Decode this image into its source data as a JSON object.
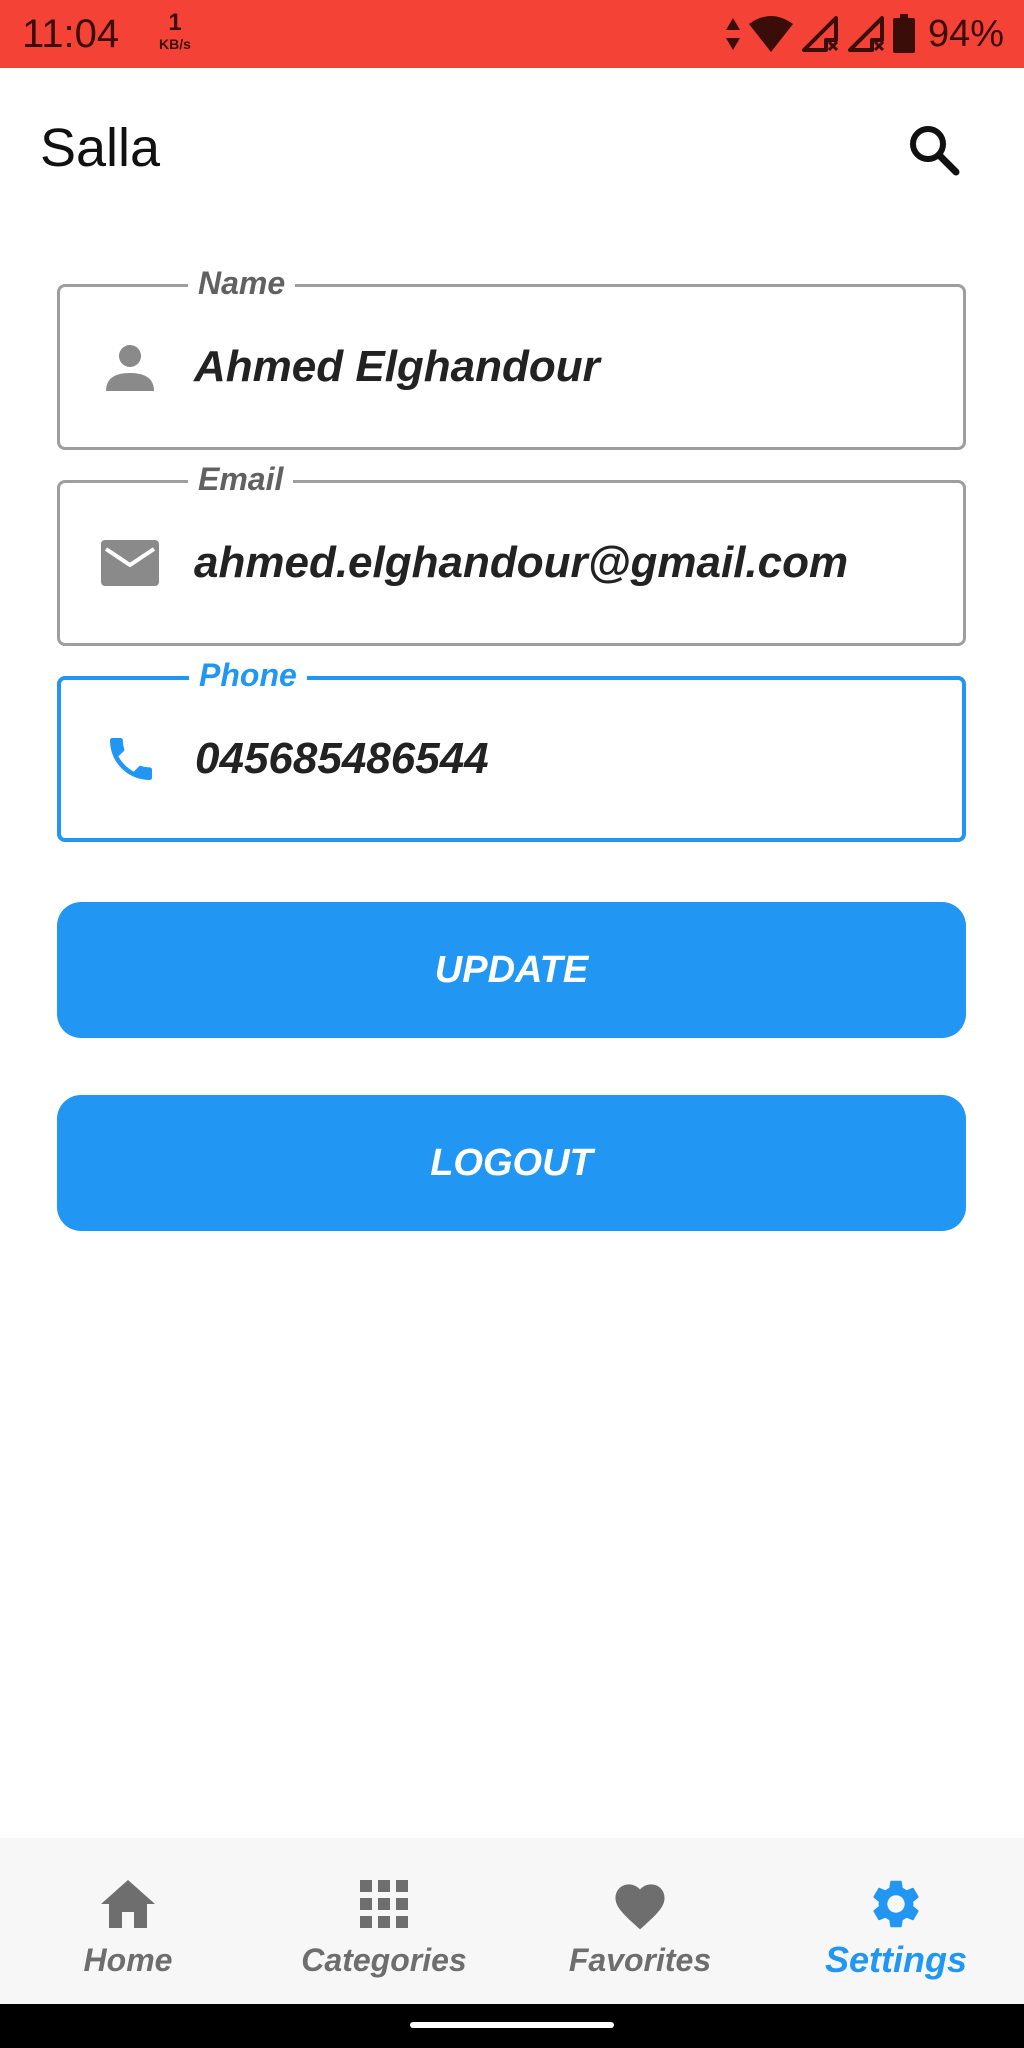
{
  "status_bar": {
    "time": "11:04",
    "net_speed_value": "1",
    "net_speed_unit": "KB/s",
    "battery": "94%",
    "icons": [
      "data-arrows-icon",
      "wifi-icon",
      "signal-no-service-icon",
      "signal-no-service-icon",
      "battery-icon"
    ]
  },
  "app_bar": {
    "title": "Salla",
    "search_icon": "search-icon"
  },
  "form": {
    "name": {
      "label": "Name",
      "value": "Ahmed Elghandour",
      "icon": "person-icon"
    },
    "email": {
      "label": "Email",
      "value": "ahmed.elghandour@gmail.com",
      "icon": "mail-icon"
    },
    "phone": {
      "label": "Phone",
      "value": "045685486544",
      "icon": "phone-icon",
      "focused": true
    }
  },
  "buttons": {
    "update": "UPDATE",
    "logout": "LOGOUT"
  },
  "bottom_nav": {
    "items": [
      {
        "label": "Home",
        "icon": "home-icon"
      },
      {
        "label": "Categories",
        "icon": "grid-icon"
      },
      {
        "label": "Favorites",
        "icon": "heart-icon"
      },
      {
        "label": "Settings",
        "icon": "gear-icon",
        "active": true
      }
    ]
  },
  "colors": {
    "status_bar": "#f44336",
    "accent": "#2196f3",
    "inactive": "#6e6e6e",
    "border": "#9e9e9e"
  }
}
